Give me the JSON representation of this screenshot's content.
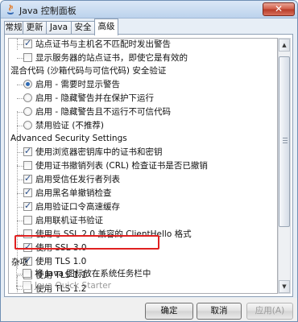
{
  "window": {
    "title": "Java 控制面板",
    "close_glyph": "✕"
  },
  "tabs": [
    {
      "label": "常规"
    },
    {
      "label": "更新"
    },
    {
      "label": "Java"
    },
    {
      "label": "安全"
    },
    {
      "label": "高级",
      "active": true
    }
  ],
  "settings": {
    "cert_items": [
      {
        "label": "站点证书与主机名不匹配时发出警告",
        "checked": true
      },
      {
        "label": "显示服务器的站点证书，即使它是有效的",
        "checked": false
      }
    ],
    "mixed_code": {
      "heading": "混合代码 (沙箱代码与可信代码) 安全验证",
      "options": [
        {
          "label": "启用 - 需要时显示警告",
          "selected": true
        },
        {
          "label": "启用 - 隐藏警告并在保护下运行",
          "selected": false
        },
        {
          "label": "启用 - 隐藏警告且不运行不可信代码",
          "selected": false
        },
        {
          "label": "禁用验证 (不推荐)",
          "selected": false
        }
      ]
    },
    "advanced_security": {
      "heading": "Advanced Security Settings",
      "items": [
        {
          "label": "使用浏览器密钥库中的证书和密钥",
          "checked": true
        },
        {
          "label": "使用证书撤销列表 (CRL) 检查证书是否已撤销",
          "checked": false
        },
        {
          "label": "启用受信任发行者列表",
          "checked": true
        },
        {
          "label": "启用黑名单撤销检查",
          "checked": true
        },
        {
          "label": "启用验证口令高速缓存",
          "checked": true
        },
        {
          "label": "启用联机证书验证",
          "checked": false
        },
        {
          "label": "使用与 SSL 2.0 兼容的 ClientHello 格式",
          "checked": false
        },
        {
          "label": "使用 SSL 3.0",
          "checked": true
        },
        {
          "label": "使用 TLS 1.0",
          "checked": true
        },
        {
          "label": "使用 TLS 1.1",
          "checked": false
        },
        {
          "label": "使用 TLS 1.2",
          "checked": false
        }
      ]
    },
    "misc": {
      "heading": "杂项",
      "tray_item": {
        "label": "将 Java 图标放在系统任务栏中",
        "checked": false
      },
      "quick_starter": {
        "label": "Java Quick Starter",
        "checked": false,
        "disabled": true
      }
    }
  },
  "buttons": {
    "ok": "确定",
    "cancel": "取消",
    "apply": "应用(A)"
  },
  "colors": {
    "highlight_border": "#e02020",
    "title_bar": "#bcd2ec"
  }
}
